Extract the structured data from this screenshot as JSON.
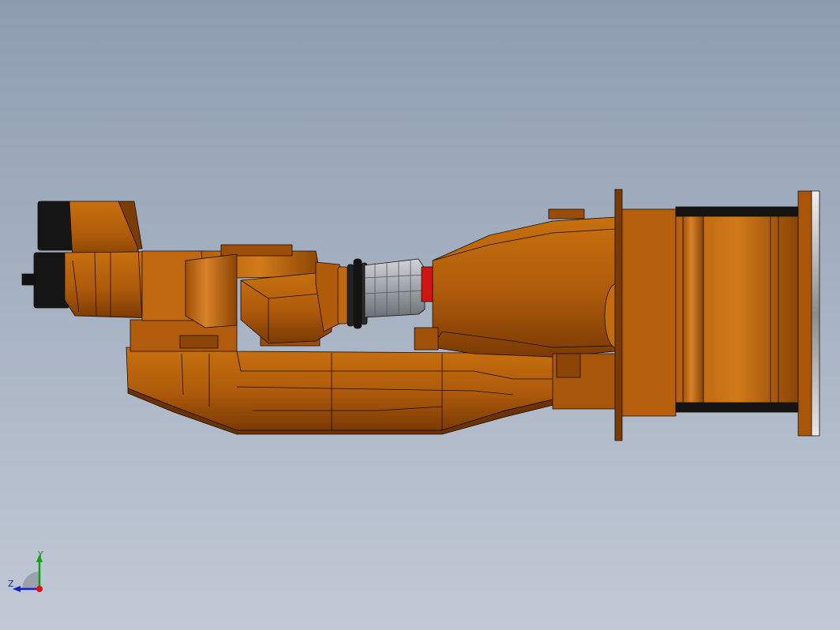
{
  "viewport": {
    "background_top": "#8d9db0",
    "background_bottom": "#c2c9d6",
    "model_color": "#b35d0c",
    "tool_color": "#a7acb1",
    "clamp_color": "#d11414",
    "motor_color": "#141414"
  },
  "triad": {
    "y_label": "Y",
    "z_label": "Z",
    "x_color": "#e01010",
    "y_color": "#10a010",
    "z_color": "#1020d0"
  }
}
